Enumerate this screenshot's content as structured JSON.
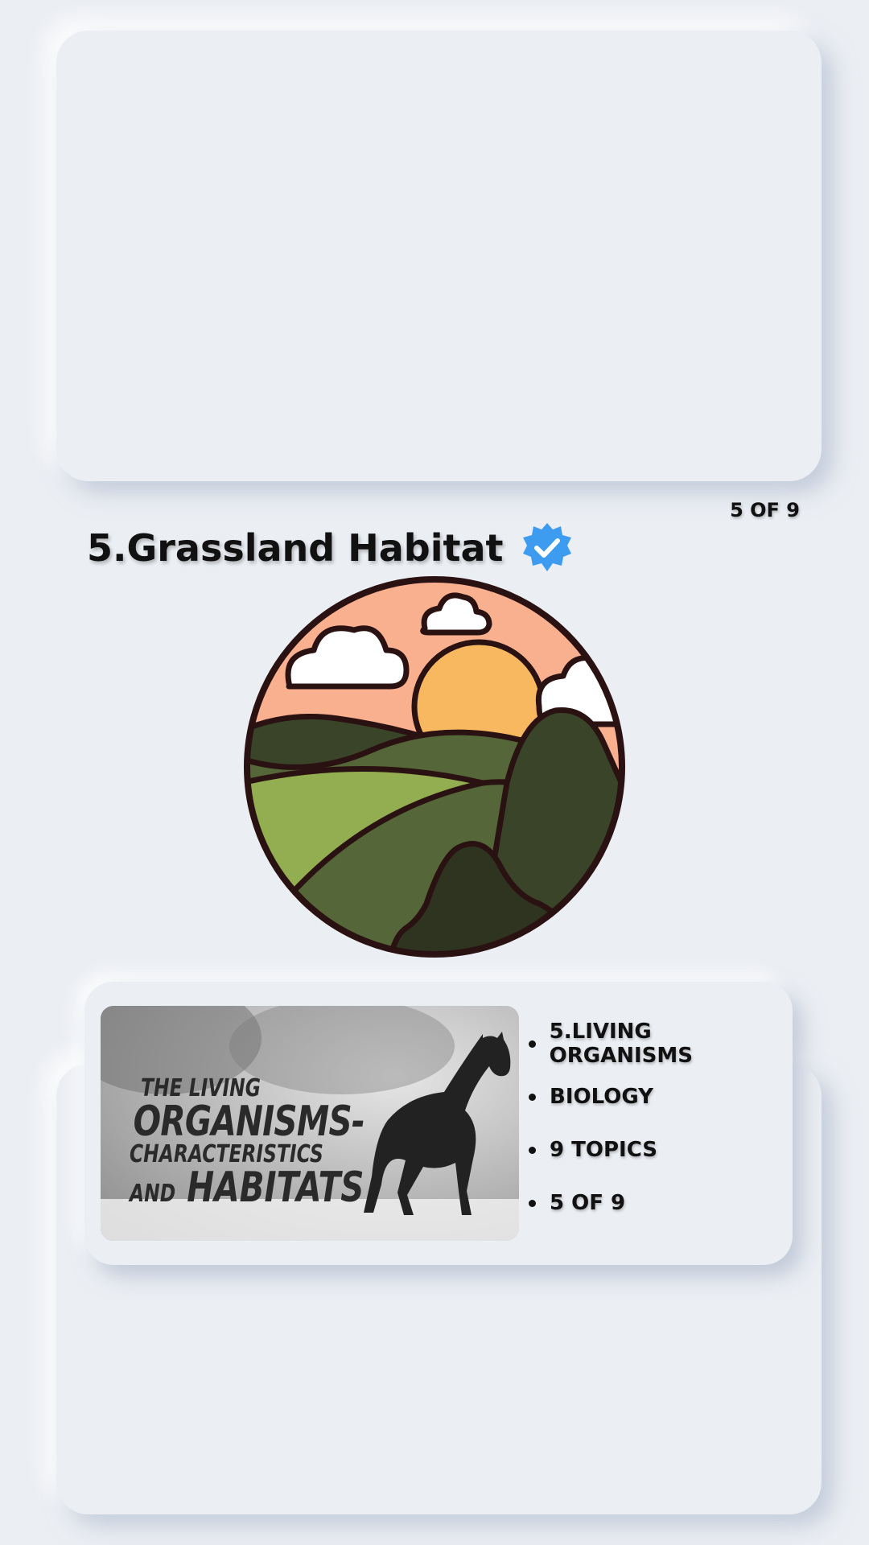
{
  "counter": "5 OF 9",
  "title": "5.Grassland Habitat",
  "icons": {
    "verified": "verified-badge-icon",
    "hero": "grassland-landscape-icon"
  },
  "colors": {
    "background": "#ebeef3",
    "verified": "#3d9bf0",
    "sky": "#f9b08f",
    "sun": "#f8b860",
    "dark_hill": "#3a4428",
    "mid_hill": "#556638",
    "light_field": "#93ad51",
    "outline": "#2a1212"
  },
  "thumbnail": {
    "line1": "THE LIVING",
    "line2": "ORGANISMS-",
    "line3": "CHARACTERISTICS",
    "line4a": "AND",
    "line4b": "HABITATS"
  },
  "info": {
    "items": [
      "5.LIVING ORGANISMS",
      "BIOLOGY",
      "9 TOPICS",
      "5 OF 9"
    ]
  }
}
